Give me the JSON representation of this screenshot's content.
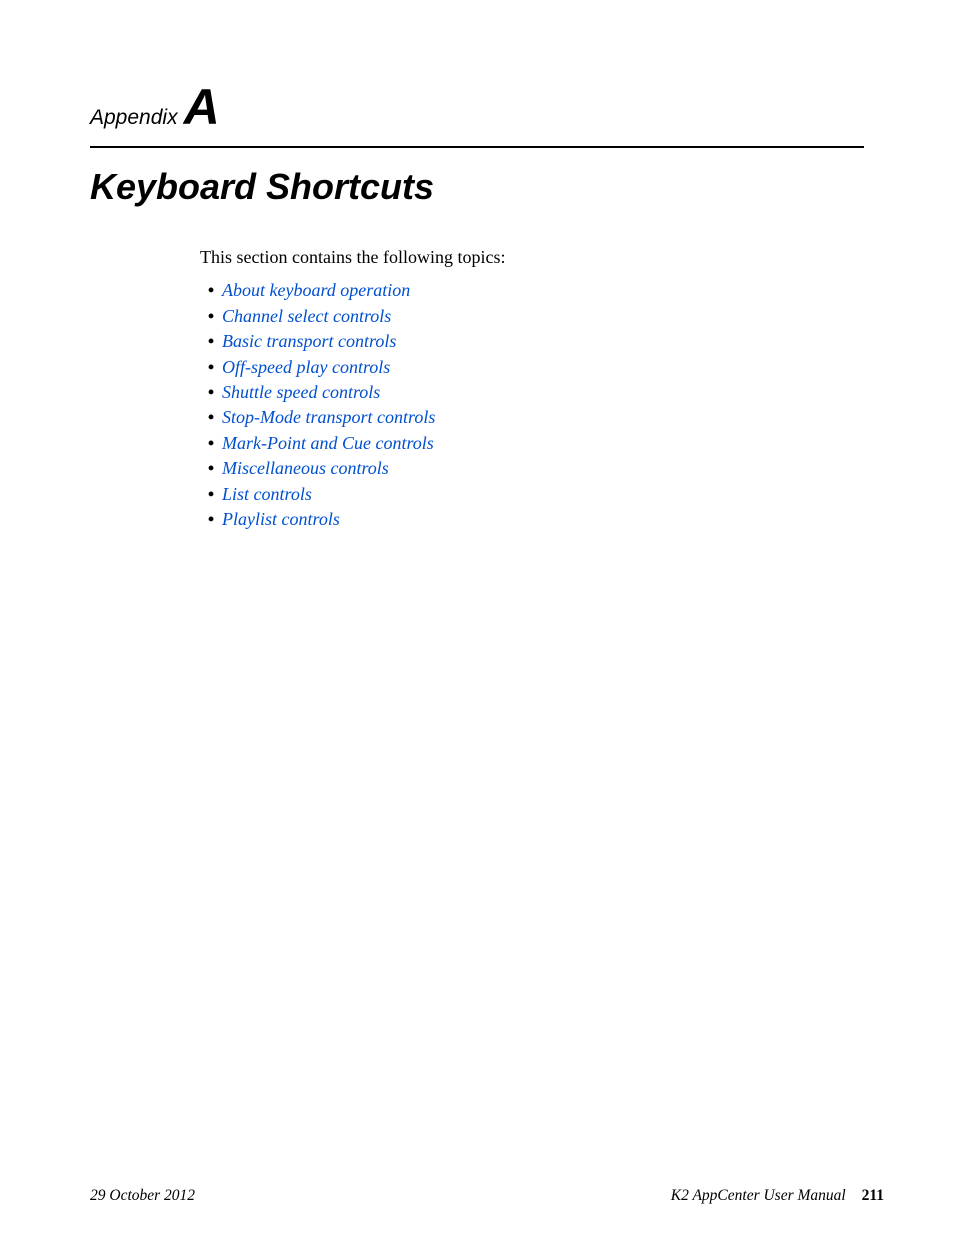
{
  "header": {
    "appendix_word": "Appendix",
    "appendix_letter": "A",
    "title": "Keyboard Shortcuts"
  },
  "body": {
    "intro": "This section contains the following topics:",
    "topics": [
      "About keyboard operation",
      "Channel select controls",
      "Basic transport controls",
      "Off-speed play controls",
      "Shuttle speed controls",
      "Stop-Mode transport controls",
      "Mark-Point and Cue controls",
      "Miscellaneous controls",
      "List controls",
      "Playlist controls"
    ]
  },
  "footer": {
    "date": "29 October 2012",
    "manual": "K2 AppCenter User Manual",
    "page": "211"
  }
}
